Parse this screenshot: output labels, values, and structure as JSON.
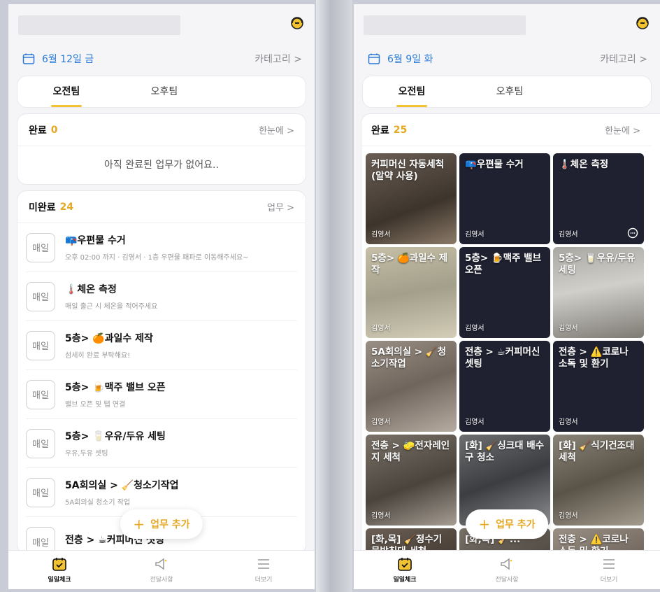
{
  "left": {
    "date": "6월 12일 금",
    "category": "카테고리 >",
    "tabs": [
      {
        "label": "오전팀"
      },
      {
        "label": "오후팀"
      }
    ],
    "done": {
      "title": "완료",
      "count": "0",
      "more": "한눈에 >",
      "empty": "아직 완료된 업무가 없어요.."
    },
    "todo": {
      "title": "미완료",
      "count": "24",
      "more": "업무 >",
      "items": [
        {
          "badge": "매일",
          "name": "📪우편물 수거",
          "sub": "오후 02:00 까지 · 김영서 · 1층 우편물 패파로 이동해주세요~"
        },
        {
          "badge": "매일",
          "name": "🌡️체온 측정",
          "sub": "매일 출근 시 체온을 적어주세요"
        },
        {
          "badge": "매일",
          "name": "5층> 🍊과일수 제작",
          "sub": "섬세히 완료 부탁해요!"
        },
        {
          "badge": "매일",
          "name": "5층> 🍺맥주 밸브 오픈",
          "sub": "밸브 오픈 및 탭 연결"
        },
        {
          "badge": "매일",
          "name": "5층> 🥛우유/두유 세팅",
          "sub": "우유,두유 셋팅"
        },
        {
          "badge": "매일",
          "name": "5A회의실 > 🧹청소기작업",
          "sub": "5A회의실 청소기 작업"
        },
        {
          "badge": "매일",
          "name": "전층 > ☕커피머신 셋팅",
          "sub": ""
        }
      ]
    },
    "fab": "업무 추가"
  },
  "right": {
    "date": "6월 9일 화",
    "category": "카테고리 >",
    "tabs": [
      {
        "label": "오전팀"
      },
      {
        "label": "오후팀"
      }
    ],
    "done": {
      "title": "완료",
      "count": "25",
      "more": "한눈에 >",
      "tiles": [
        {
          "label": "커피머신 자동세척 (알약 사용)",
          "who": "김영서"
        },
        {
          "label": "📪우편물 수거",
          "who": "김영서"
        },
        {
          "label": "🌡️체온 측정",
          "who": "김영서"
        },
        {
          "label": "5층> 🍊과일수 제작",
          "who": "김영서"
        },
        {
          "label": "5층> 🍺맥주 밸브 오픈",
          "who": "김영서"
        },
        {
          "label": "5층> 🥛우유/두유 세팅",
          "who": "김영서"
        },
        {
          "label": "5A회의실 > 🧹청소기작업",
          "who": "김영서"
        },
        {
          "label": "전층 > ☕커피머신 셋팅",
          "who": "김영서"
        },
        {
          "label": "전층 > ⚠️코로나 소독 및 환기",
          "who": "김영서"
        },
        {
          "label": "전층 > 🧽전자레인지 세척",
          "who": "김영서"
        },
        {
          "label": "[화] 🧹싱크대 배수구 청소",
          "who": ""
        },
        {
          "label": "[화] 🧹식기건조대 세척",
          "who": "김영서"
        },
        {
          "label": "[화,목] 🧹정수기 물받침대 세척",
          "who": ""
        },
        {
          "label": "[화,목] 🧹...",
          "who": ""
        },
        {
          "label": "전층 > ⚠️코로나 소독 및 환기",
          "who": ""
        }
      ]
    },
    "fab": "업무 추가"
  },
  "nav": [
    {
      "label": "일일체크",
      "icon": "calendar-check-icon"
    },
    {
      "label": "전달사항",
      "icon": "megaphone-icon"
    },
    {
      "label": "더보기",
      "icon": "menu-icon"
    }
  ],
  "colors": {
    "accent": "#e5a823",
    "date": "#2a7bd7",
    "tile_dark": "#1f2030"
  }
}
